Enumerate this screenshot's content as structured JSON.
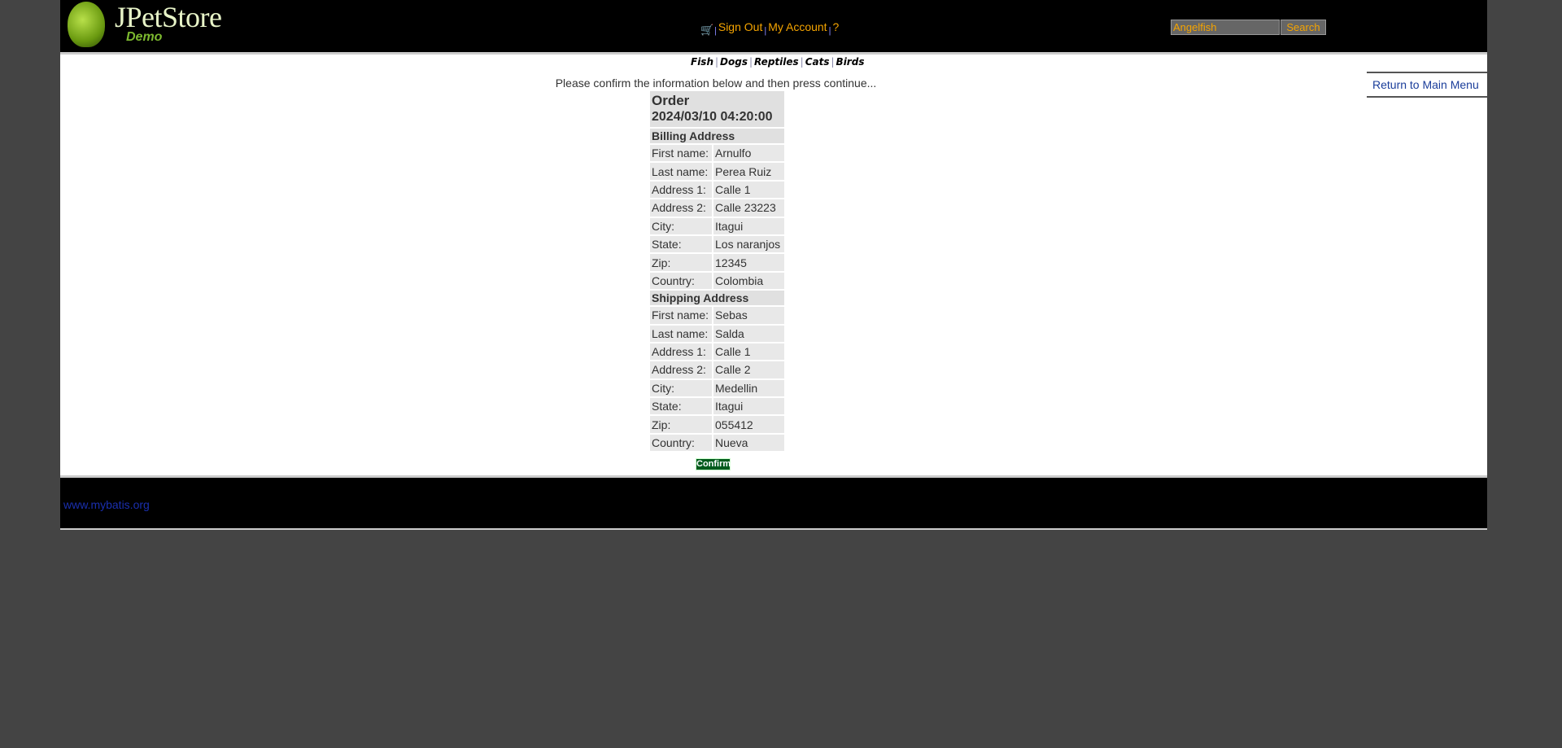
{
  "header": {
    "logo_name": "JPetStore",
    "logo_sub": "Demo",
    "cart_icon": "cart-icon",
    "sign_out": "Sign Out",
    "my_account": "My Account",
    "help": "?",
    "separator": "|",
    "search_value": "Angelfish",
    "search_button": "Search"
  },
  "categories": [
    "Fish",
    "Dogs",
    "Reptiles",
    "Cats",
    "Birds"
  ],
  "main": {
    "message": "Please confirm the information below and then press continue...",
    "return_link": "Return to Main Menu",
    "order_title": "Order",
    "order_date": "2024/03/10 04:20:00",
    "billing_title": "Billing Address",
    "billing": [
      [
        "First name:",
        "Arnulfo"
      ],
      [
        "Last name:",
        "Perea Ruiz"
      ],
      [
        "Address 1:",
        "Calle 1"
      ],
      [
        "Address 2:",
        "Calle 23223"
      ],
      [
        "City:",
        "Itagui"
      ],
      [
        "State:",
        "Los naranjos"
      ],
      [
        "Zip:",
        "12345"
      ],
      [
        "Country:",
        "Colombia"
      ]
    ],
    "shipping_title": "Shipping Address",
    "shipping": [
      [
        "First name:",
        "Sebas"
      ],
      [
        "Last name:",
        "Salda"
      ],
      [
        "Address 1:",
        "Calle 1"
      ],
      [
        "Address 2:",
        "Calle 2"
      ],
      [
        "City:",
        "Medellin"
      ],
      [
        "State:",
        "Itagui"
      ],
      [
        "Zip:",
        "055412"
      ],
      [
        "Country:",
        "Nueva"
      ]
    ],
    "confirm_button": "Confirm"
  },
  "footer": {
    "link": "www.mybatis.org"
  }
}
